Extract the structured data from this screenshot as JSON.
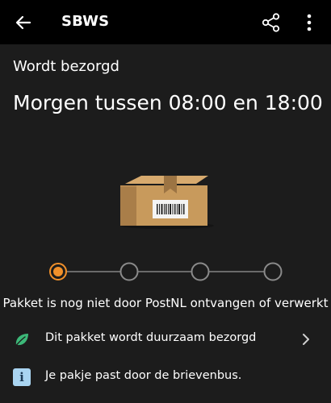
{
  "appbar": {
    "title": "SBWS",
    "back_icon": "arrow-left-icon",
    "share_icon": "share-icon",
    "more_icon": "more-vertical-icon"
  },
  "shipment": {
    "status": "Wordt bezorgd",
    "eta": "Morgen tussen 08:00 en 18:00",
    "illustration": "package-box-icon"
  },
  "progress": {
    "current_step": 1,
    "total_steps": 4,
    "step_text": "Pakket is nog niet door PostNL ontvangen of verwerkt",
    "active_color": "#f0902a"
  },
  "info_rows": [
    {
      "icon": "leaf-icon",
      "label": "Dit pakket wordt duurzaam bezorgd",
      "has_chevron": true,
      "icon_color": "#3cb878"
    },
    {
      "icon": "info-icon",
      "label": "Je pakje past door de brievenbus.",
      "has_chevron": false,
      "icon_color": "#a9d4f1"
    }
  ]
}
